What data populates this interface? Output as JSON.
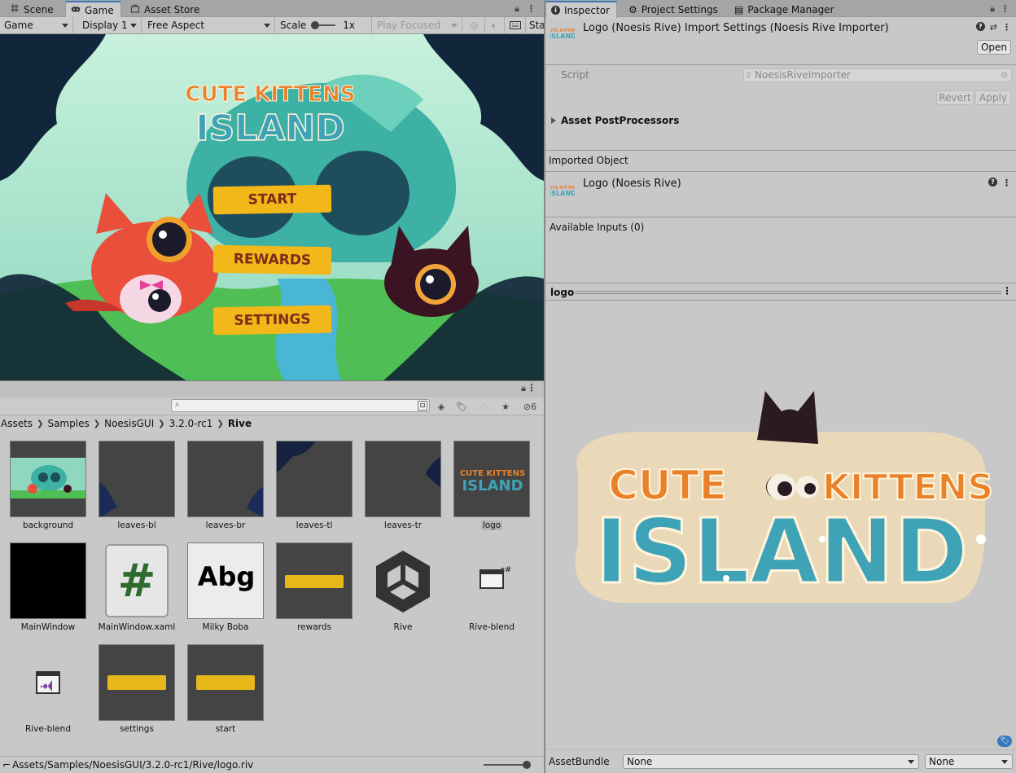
{
  "left_tabs": {
    "scene": "Scene",
    "game": "Game",
    "asset_store": "Asset Store"
  },
  "game_toolbar": {
    "view_mode": "Game",
    "display": "Display 1",
    "aspect": "Free Aspect",
    "scale_label": "Scale",
    "scale_value": "1x",
    "play_mode": "Play Focused",
    "stats": "Sta"
  },
  "game_view": {
    "logo_top": "CUTE KITTENS",
    "logo_bottom": "ISLAND",
    "buttons": [
      "START",
      "REWARDS",
      "SETTINGS"
    ]
  },
  "project": {
    "hidden_count": "6",
    "breadcrumb": [
      "Assets",
      "Samples",
      "NoesisGUI",
      "3.2.0-rc1",
      "Rive"
    ],
    "assets": [
      {
        "label": "background",
        "kind": "background"
      },
      {
        "label": "leaves-bl",
        "kind": "leaves-bl"
      },
      {
        "label": "leaves-br",
        "kind": "leaves-br"
      },
      {
        "label": "leaves-tl",
        "kind": "leaves-tl"
      },
      {
        "label": "leaves-tr",
        "kind": "leaves-tr"
      },
      {
        "label": "logo",
        "kind": "logo",
        "selected": true
      },
      {
        "label": "MainWindow",
        "kind": "black"
      },
      {
        "label": "MainWindow.xaml",
        "kind": "xaml"
      },
      {
        "label": "Milky Boba",
        "kind": "font"
      },
      {
        "label": "rewards",
        "kind": "bar"
      },
      {
        "label": "Rive",
        "kind": "unity"
      },
      {
        "label": "Rive-blend",
        "kind": "csharp"
      },
      {
        "label": "Rive-blend",
        "kind": "vs"
      },
      {
        "label": "settings",
        "kind": "bar"
      },
      {
        "label": "start",
        "kind": "bar"
      }
    ],
    "font_preview": "Abg",
    "xaml_glyph": "#",
    "status_path": "Assets/Samples/NoesisGUI/3.2.0-rc1/Rive/logo.riv"
  },
  "right_tabs": {
    "inspector": "Inspector",
    "project_settings": "Project Settings",
    "package_manager": "Package Manager"
  },
  "inspector": {
    "title": "Logo (Noesis Rive) Import Settings (Noesis Rive Importer)",
    "open_button": "Open",
    "script_label": "Script",
    "script_value": "NoesisRiveImporter",
    "revert": "Revert",
    "apply": "Apply",
    "asset_postprocessors": "Asset PostProcessors",
    "imported_object": "Imported Object",
    "imported_name": "Logo (Noesis Rive)",
    "available_inputs": "Available Inputs (0)",
    "preview_name": "logo",
    "asset_bundle_label": "AssetBundle",
    "asset_bundle_value": "None",
    "asset_bundle_variant": "None"
  },
  "colors": {
    "accent_blue": "#3a79bb",
    "logo_orange": "#e9812a",
    "logo_teal": "#3fa3b8",
    "button_yellow": "#f2b819",
    "button_text": "#7a2d1a"
  }
}
